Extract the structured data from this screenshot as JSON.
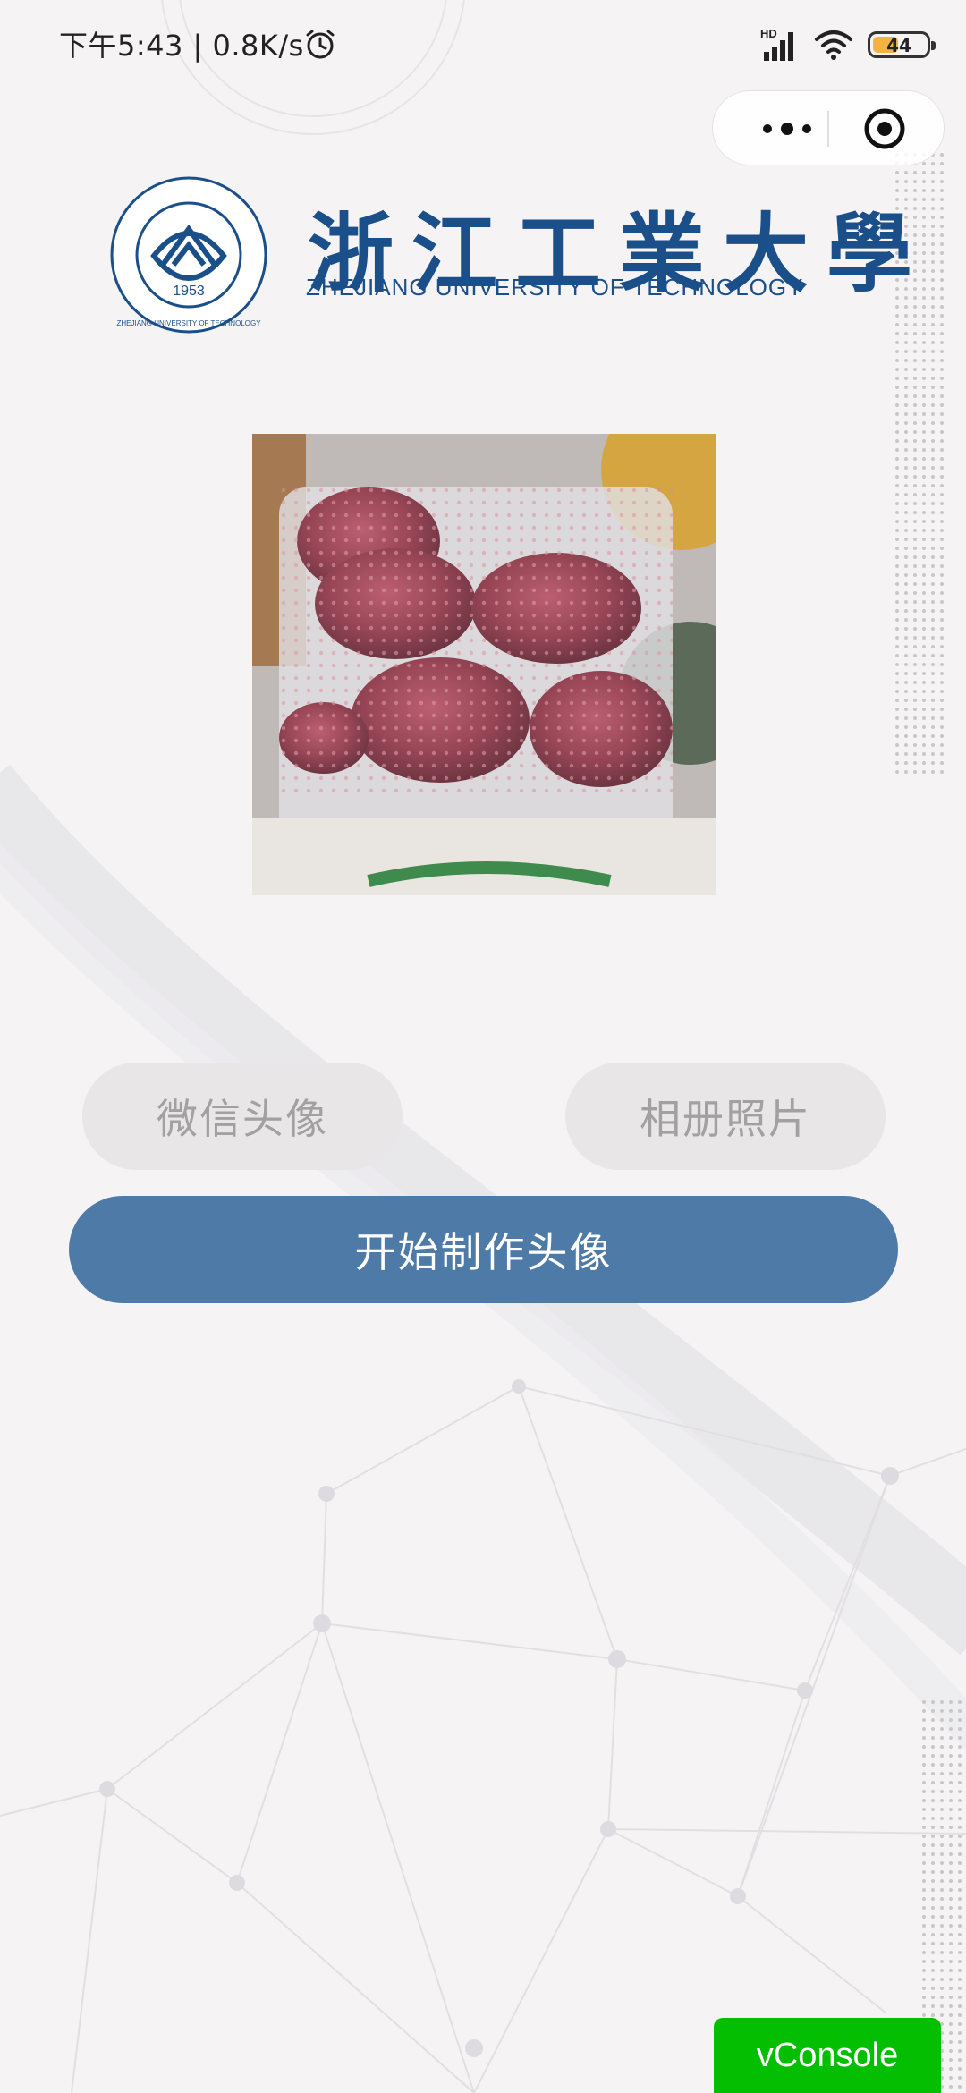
{
  "status_bar": {
    "time_speed": "下午5:43 | 0.8K/s",
    "network_badge": "HD",
    "battery_level": "44"
  },
  "capsule": {
    "more_icon": "more-dots-icon",
    "close_icon": "close-target-icon"
  },
  "logo": {
    "cn_name": "浙江工業大學",
    "en_name": "ZHEJIANG UNIVERSITY OF TECHNOLOGY",
    "seal_year": "1953",
    "seal_ring_text": "ZHEJIANG UNIVERSITY OF TECHNOLOGY"
  },
  "buttons": {
    "wechat_avatar": "微信头像",
    "album_photo": "相册照片",
    "start": "开始制作头像"
  },
  "vconsole": {
    "label": "vConsole"
  },
  "colors": {
    "primary_button": "#4e7aa8",
    "pill_button": "#e9e6e7",
    "vconsole": "#04be02",
    "logo_blue": "#1a4f8a"
  }
}
